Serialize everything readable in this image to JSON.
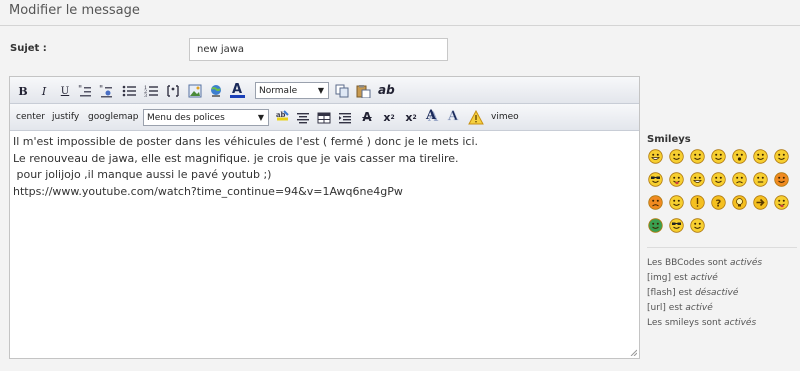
{
  "page": {
    "title": "Modifier le message"
  },
  "subject": {
    "label": "Sujet :",
    "value": "new jawa"
  },
  "toolbar": {
    "bold": "B",
    "italic": "I",
    "underline": "U",
    "font_size_select": "Normale",
    "spellcheck": "ab",
    "center": "center",
    "justify": "justify",
    "googlemap": "googlemap",
    "font_select": "Menu des polices",
    "vimeo": "vimeo",
    "colors": {
      "underline_bar": "#1a3fb8",
      "warning": "#e8b21a"
    }
  },
  "message": {
    "lines": [
      "Il m'est impossible de poster dans les véhicules de l'est ( fermé ) donc je le mets ici.",
      "",
      "Le renouveau de jawa, elle est magnifique. je crois que je vais casser ma tirelire.",
      "",
      " pour jolijojo ,il manque aussi le pavé youtub ;)",
      "",
      "https://www.youtube.com/watch?time_continue=94&v=1Awq6ne4gPw"
    ]
  },
  "smileys": {
    "title": "Smileys",
    "items": [
      "grin-smiley",
      "smile-smiley",
      "blush-smiley",
      "happy-smiley",
      "surprised-smiley",
      "roll-eyes-smiley",
      "pleased-smiley",
      "cool-smiley",
      "tongue-smiley",
      "laugh-smiley",
      "wink-smiley",
      "sad-smiley",
      "neutral-smiley",
      "evil-smiley",
      "mad-smiley",
      "confused-smiley",
      "exclaim-smiley",
      "question-smiley",
      "idea-smiley",
      "arrow-smiley",
      "tongue-wink-smiley",
      "sick-smiley",
      "glasses-smiley",
      "crazy-smiley"
    ]
  },
  "bbcode_info": {
    "line1": {
      "prefix": "Les BBCodes sont ",
      "status": "activés"
    },
    "line2": {
      "prefix": "[img] est ",
      "status": "activé"
    },
    "line3": {
      "prefix": "[flash] est ",
      "status": "désactivé"
    },
    "line4": {
      "prefix": "[url] est ",
      "status": "activé"
    },
    "line5": {
      "prefix": "Les smileys sont ",
      "status": "activés"
    }
  }
}
